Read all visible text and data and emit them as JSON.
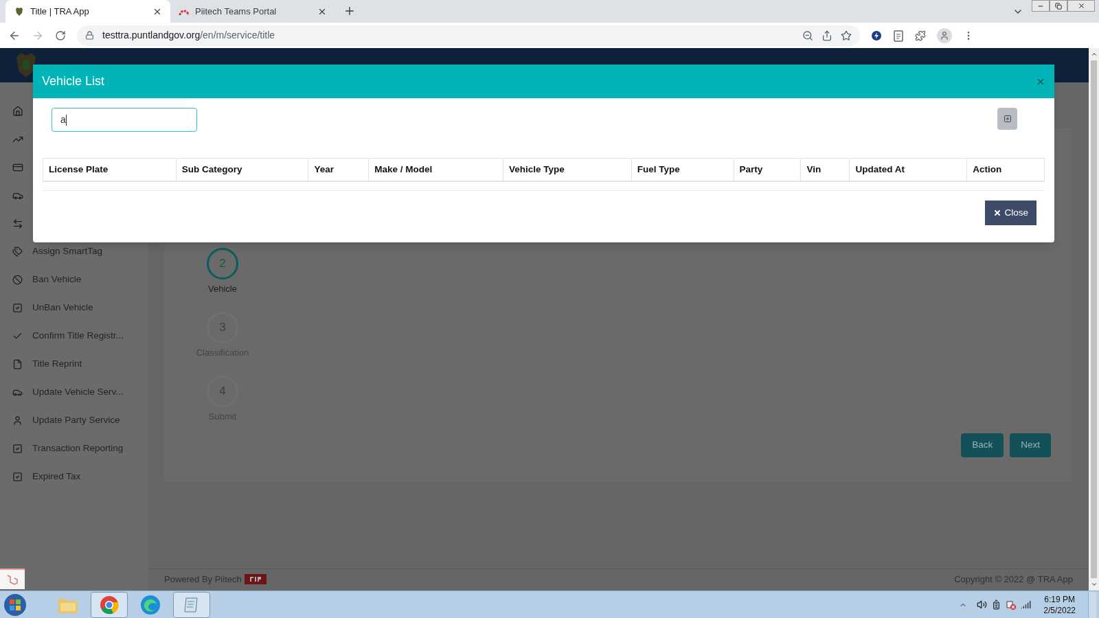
{
  "browser": {
    "tabs": [
      {
        "title": "Title | TRA App",
        "selected": true
      },
      {
        "title": "Piitech Teams Portal",
        "selected": false
      }
    ],
    "url_host": "testtra.puntlandgov.org",
    "url_path": "/en/m/service/title"
  },
  "sidebar": {
    "items": [
      {
        "label": "Assign SmartTag"
      },
      {
        "label": "Ban Vehicle"
      },
      {
        "label": "UnBan Vehicle"
      },
      {
        "label": "Confirm Title Registr..."
      },
      {
        "label": "Title Reprint"
      },
      {
        "label": "Update Vehicle Serv..."
      },
      {
        "label": "Update Party Service"
      },
      {
        "label": "Transaction Reporting"
      },
      {
        "label": "Expired Tax"
      }
    ]
  },
  "steps": [
    {
      "number": "2",
      "label": "Vehicle",
      "selected": true
    },
    {
      "number": "3",
      "label": "Classification",
      "selected": false
    },
    {
      "number": "4",
      "label": "Submit",
      "selected": false
    }
  ],
  "wizard_buttons": [
    "Back",
    "Next"
  ],
  "footer": {
    "powered_by": "Powered By Piitech",
    "copyright": "Copyright © 2022 @ TRA App"
  },
  "modal": {
    "title": "Vehicle List",
    "search": {
      "value": "a"
    },
    "columns": [
      "License Plate",
      "Sub Category",
      "Year",
      "Make / Model",
      "Vehicle Type",
      "Fuel Type",
      "Party",
      "Vin",
      "Updated At",
      "Action"
    ],
    "close_button": "Close"
  },
  "taskbar": {
    "time": "6:19 PM",
    "date": "2/5/2022"
  }
}
